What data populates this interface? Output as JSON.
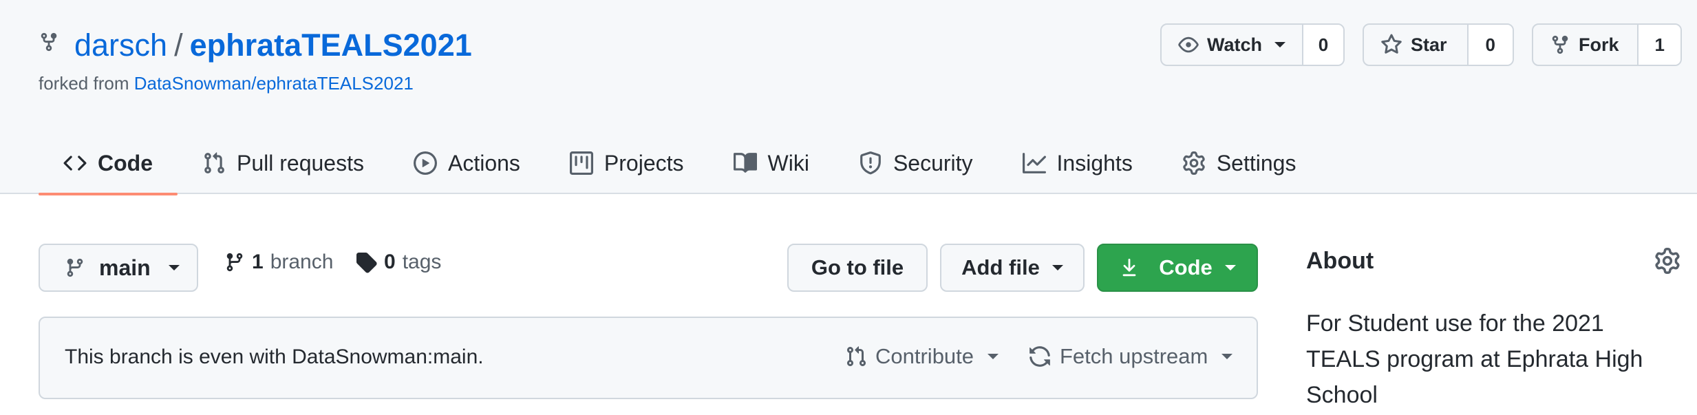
{
  "repo": {
    "owner": "darsch",
    "separator": "/",
    "name": "ephrataTEALS2021",
    "forked_prefix": "forked from ",
    "forked_source": "DataSnowman/ephrataTEALS2021"
  },
  "actions": {
    "watch": {
      "label": "Watch",
      "count": "0",
      "icon": "eye-icon"
    },
    "star": {
      "label": "Star",
      "count": "0",
      "icon": "star-icon"
    },
    "fork": {
      "label": "Fork",
      "count": "1",
      "icon": "fork-icon"
    }
  },
  "tabs": [
    {
      "label": "Code",
      "icon": "code-icon",
      "selected": true
    },
    {
      "label": "Pull requests",
      "icon": "pull-request-icon"
    },
    {
      "label": "Actions",
      "icon": "play-icon"
    },
    {
      "label": "Projects",
      "icon": "project-icon"
    },
    {
      "label": "Wiki",
      "icon": "book-icon"
    },
    {
      "label": "Security",
      "icon": "shield-icon"
    },
    {
      "label": "Insights",
      "icon": "graph-icon"
    },
    {
      "label": "Settings",
      "icon": "gear-icon"
    }
  ],
  "branch": {
    "current": "main",
    "branch_count": "1",
    "branch_label": "branch",
    "tag_count": "0",
    "tag_label": "tags"
  },
  "file_actions": {
    "goto": "Go to file",
    "add": "Add file",
    "code": "Code"
  },
  "notice": {
    "text": "This branch is even with DataSnowman:main.",
    "contribute": "Contribute",
    "fetch": "Fetch upstream"
  },
  "about": {
    "title": "About",
    "description": "For Student use for the 2021 TEALS program at Ephrata High School"
  },
  "colors": {
    "link": "#0969da",
    "accent_underline": "#fd8c73",
    "primary_button": "#2da44e"
  }
}
